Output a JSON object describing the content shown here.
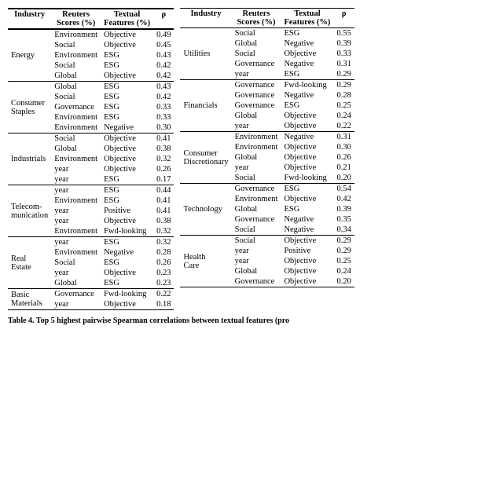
{
  "caption": "Table 4. Top 5 highest pairwise Spearman correlations between textual features (pro",
  "table_left": {
    "headers": [
      "Industry",
      "Reuters\nScores (%)",
      "Textual\nFeatures (%)",
      "ρ"
    ],
    "sections": [
      {
        "label": "Energy",
        "rows": [
          [
            "Environment",
            "Objective",
            "0.49"
          ],
          [
            "Social",
            "Objective",
            "0.45"
          ],
          [
            "Environment",
            "ESG",
            "0.43"
          ],
          [
            "Social",
            "ESG",
            "0.42"
          ],
          [
            "Global",
            "Objective",
            "0.42"
          ]
        ]
      },
      {
        "label": "Consumer\nStaples",
        "rows": [
          [
            "Global",
            "ESG",
            "0.43"
          ],
          [
            "Social",
            "ESG",
            "0.42"
          ],
          [
            "Governance",
            "ESG",
            "0.33"
          ],
          [
            "Environment",
            "ESG",
            "0.33"
          ],
          [
            "Environment",
            "Negative",
            "0.30"
          ]
        ]
      },
      {
        "label": "Industrials",
        "rows": [
          [
            "Social",
            "Objective",
            "0.41"
          ],
          [
            "Global",
            "Objective",
            "0.38"
          ],
          [
            "Environment",
            "Objective",
            "0.32"
          ],
          [
            "year",
            "Objective",
            "0.26"
          ],
          [
            "year",
            "ESG",
            "0.17"
          ]
        ]
      },
      {
        "label": "Telecom-\nmunication",
        "rows": [
          [
            "year",
            "ESG",
            "0.44"
          ],
          [
            "Environment",
            "ESG",
            "0.41"
          ],
          [
            "year",
            "Positive",
            "0.41"
          ],
          [
            "year",
            "Objective",
            "0.38"
          ],
          [
            "Environment",
            "Fwd-looking",
            "0.32"
          ]
        ]
      },
      {
        "label": "Real\nEstate",
        "rows": [
          [
            "year",
            "ESG",
            "0.32"
          ],
          [
            "Environment",
            "Negative",
            "0.28"
          ],
          [
            "Social",
            "ESG",
            "0.26"
          ],
          [
            "year",
            "Objective",
            "0.23"
          ],
          [
            "Global",
            "ESG",
            "0.23"
          ]
        ]
      },
      {
        "label": "Basic\nMaterials",
        "rows": [
          [
            "Governance",
            "Fwd-looking",
            "0.22"
          ],
          [
            "year",
            "Objective",
            "0.18"
          ]
        ]
      }
    ]
  },
  "table_right": {
    "headers": [
      "Industry",
      "Reuters\nScores (%)",
      "Textual\nFeatures (%)",
      "ρ"
    ],
    "sections": [
      {
        "label": "Utilities",
        "rows": [
          [
            "Social",
            "ESG",
            "0.55"
          ],
          [
            "Global",
            "Negative",
            "0.39"
          ],
          [
            "Social",
            "Objective",
            "0.33"
          ],
          [
            "Governance",
            "Negative",
            "0.31"
          ],
          [
            "year",
            "ESG",
            "0.29"
          ]
        ]
      },
      {
        "label": "Financials",
        "rows": [
          [
            "Governance",
            "Fwd-looking",
            "0.29"
          ],
          [
            "Governance",
            "Negative",
            "0.28"
          ],
          [
            "Governance",
            "ESG",
            "0.25"
          ],
          [
            "Global",
            "Objective",
            "0.24"
          ],
          [
            "year",
            "Objective",
            "0.22"
          ]
        ]
      },
      {
        "label": "Consumer\nDiscretionary",
        "rows": [
          [
            "Environment",
            "Negative",
            "0.31"
          ],
          [
            "Environment",
            "Objective",
            "0.30"
          ],
          [
            "Global",
            "Objective",
            "0.26"
          ],
          [
            "year",
            "Objective",
            "0.21"
          ],
          [
            "Social",
            "Fwd-looking",
            "0.20"
          ]
        ]
      },
      {
        "label": "Technology",
        "rows": [
          [
            "Governance",
            "ESG",
            "0.54"
          ],
          [
            "Environment",
            "Objective",
            "0.42"
          ],
          [
            "Global",
            "ESG",
            "0.39"
          ],
          [
            "Governance",
            "Negative",
            "0.35"
          ],
          [
            "Social",
            "Negative",
            "0.34"
          ]
        ]
      },
      {
        "label": "Health\nCare",
        "rows": [
          [
            "Social",
            "Objective",
            "0.29"
          ],
          [
            "year",
            "Positive",
            "0.29"
          ],
          [
            "year",
            "Objective",
            "0.25"
          ],
          [
            "Global",
            "Objective",
            "0.24"
          ],
          [
            "Governance",
            "Objective",
            "0.20"
          ]
        ]
      }
    ]
  }
}
